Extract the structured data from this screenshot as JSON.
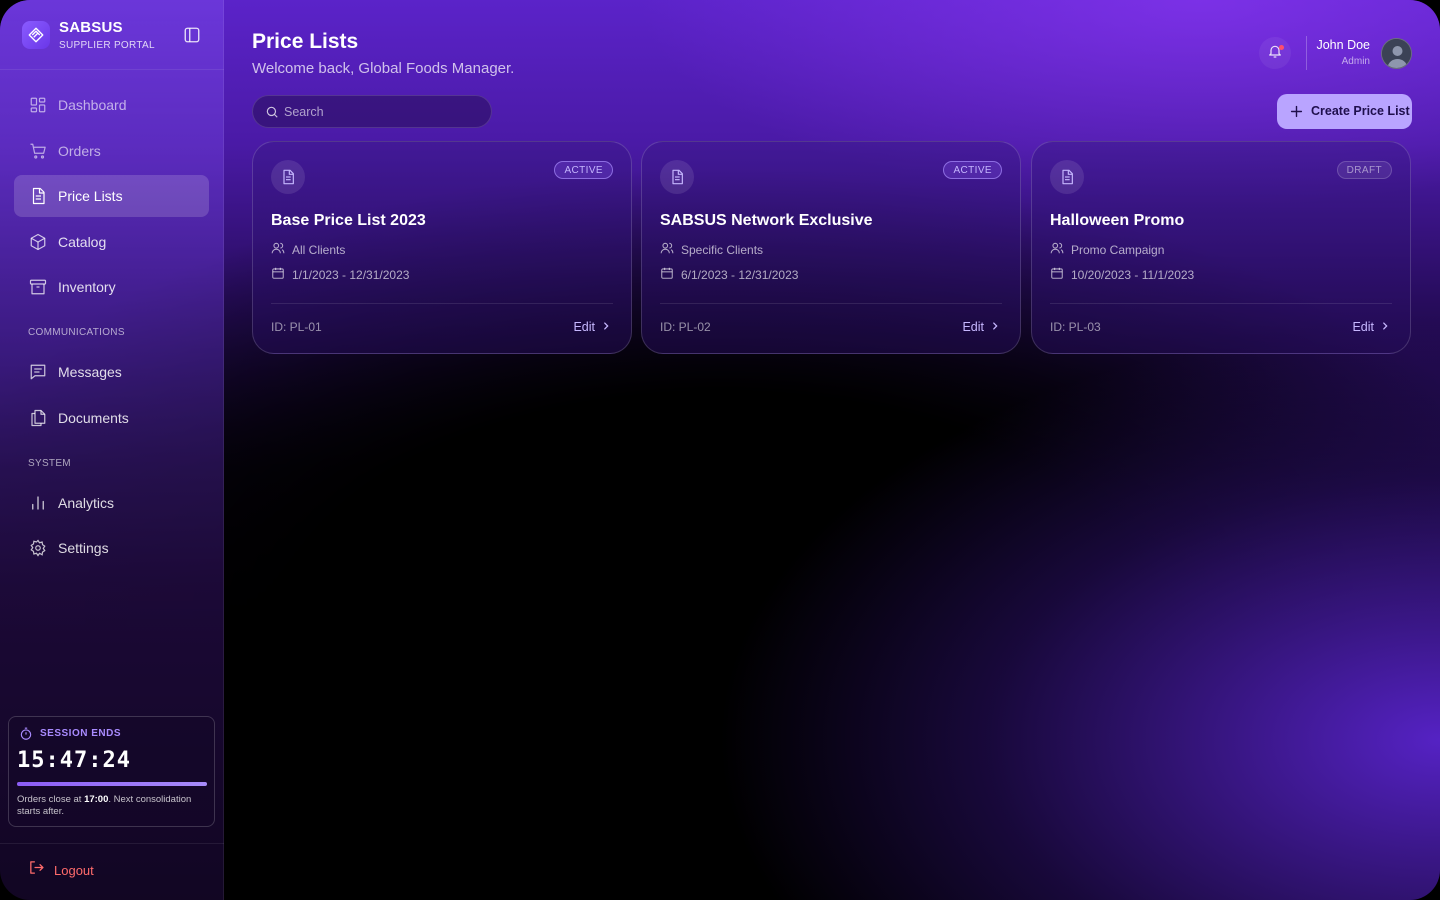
{
  "brand": {
    "name": "SABSUS",
    "subtitle": "SUPPLIER PORTAL"
  },
  "sidebar": {
    "items": [
      {
        "label": "Dashboard",
        "icon": "grid-icon"
      },
      {
        "label": "Orders",
        "icon": "cart-icon"
      },
      {
        "label": "Price Lists",
        "icon": "document-icon",
        "active": true
      },
      {
        "label": "Catalog",
        "icon": "cube-icon"
      },
      {
        "label": "Inventory",
        "icon": "archive-icon"
      }
    ],
    "sections": {
      "communications": "COMMUNICATIONS",
      "system": "SYSTEM"
    },
    "communications_items": [
      {
        "label": "Messages",
        "icon": "message-icon"
      },
      {
        "label": "Documents",
        "icon": "files-icon"
      }
    ],
    "system_items": [
      {
        "label": "Analytics",
        "icon": "bar-chart-icon"
      },
      {
        "label": "Settings",
        "icon": "gear-icon"
      }
    ],
    "logout": "Logout"
  },
  "session": {
    "title": "SESSION ENDS",
    "time": "15:47:24",
    "progress": 1.0,
    "note_prefix": "Orders close at ",
    "note_time": "17:00",
    "note_suffix": ". Next consolidation starts after."
  },
  "header": {
    "title": "Price Lists",
    "subtitle": "Welcome back, Global Foods Manager.",
    "user": {
      "name": "John Doe",
      "role": "Admin"
    }
  },
  "search": {
    "placeholder": "Search",
    "value": ""
  },
  "actions": {
    "create": "Create Price List"
  },
  "cards": [
    {
      "status": "ACTIVE",
      "title": "Base Price List 2023",
      "audience": "All Clients",
      "dates": "1/1/2023 - 12/31/2023",
      "id": "ID: PL-01",
      "edit": "Edit"
    },
    {
      "status": "ACTIVE",
      "title": "SABSUS Network Exclusive",
      "audience": "Specific Clients",
      "dates": "6/1/2023 - 12/31/2023",
      "id": "ID: PL-02",
      "edit": "Edit"
    },
    {
      "status": "DRAFT",
      "title": "Halloween Promo",
      "audience": "Promo Campaign",
      "dates": "10/20/2023 - 11/1/2023",
      "id": "ID: PL-03",
      "edit": "Edit"
    }
  ],
  "colors": {
    "accent": "#8b5cf6",
    "button": "#b9a4ff",
    "logout": "#ff6b6b",
    "notification": "#ff4d6d"
  }
}
